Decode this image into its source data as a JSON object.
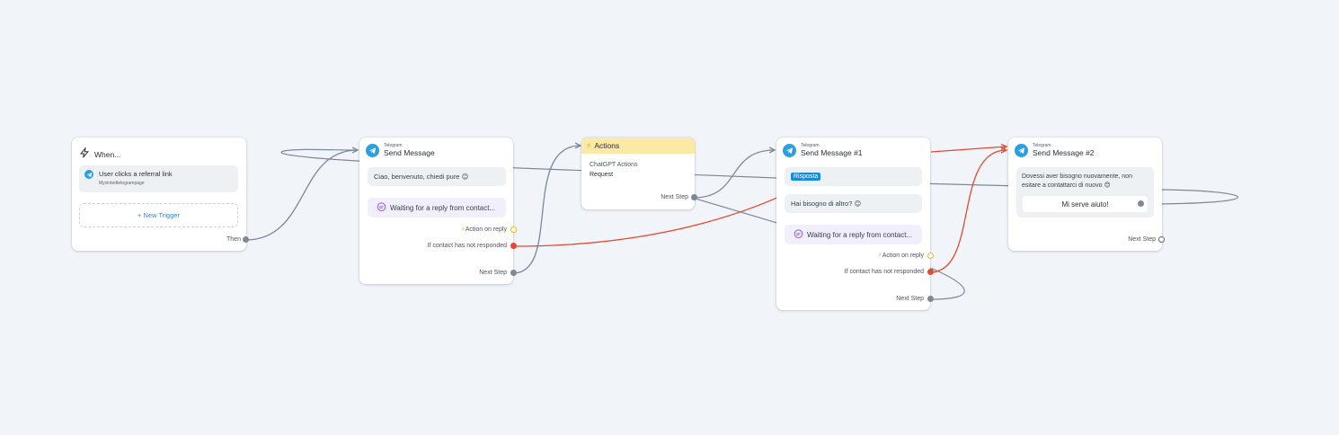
{
  "colors": {
    "canvas": "#f1f4f8",
    "edge_gray": "#7d8898",
    "edge_red": "#e34a2f",
    "telegram_blue": "#2aa1de",
    "actions_header": "#fde9a6",
    "waiting_bg": "#f2effc",
    "badge_blue": "#1b8bd6"
  },
  "trigger_node": {
    "title": "When...",
    "icon": "lightning-icon",
    "trigger": {
      "label": "User clicks a referral link",
      "sublabel": "Myvintedtelegrampage",
      "icon": "telegram-icon"
    },
    "new_trigger_label": "+ New Trigger",
    "output_label": "Then"
  },
  "send_message_1": {
    "platform": "Telegram",
    "title": "Send Message",
    "message": "Ciao, benvenuto, chiedi pure 😊",
    "waiting": "Waiting for a reply from contact...",
    "action_on_reply": "Action on reply",
    "not_responded": "If contact has not responded",
    "next_step": "Next Step"
  },
  "actions_node": {
    "title": "Actions",
    "line1": "ChatGPT Actions",
    "line2": "Request",
    "next_step": "Next Step"
  },
  "send_message_2": {
    "platform": "Telegram",
    "title": "Send Message #1",
    "badge": "Risposta",
    "message": "Hai bisogno di altro? 😊",
    "waiting": "Waiting for a reply from contact...",
    "action_on_reply": "Action on reply",
    "not_responded": "If contact has not responded",
    "next_step": "Next Step"
  },
  "send_message_3": {
    "platform": "Telegram",
    "title": "Send Message #2",
    "message_line1": "Dovessi aver bisogno nuovamente, non",
    "message_line2": "esitare a contattarci di nuovo 😊",
    "button_label": "Mi serve aiuto!",
    "next_step": "Next Step"
  }
}
